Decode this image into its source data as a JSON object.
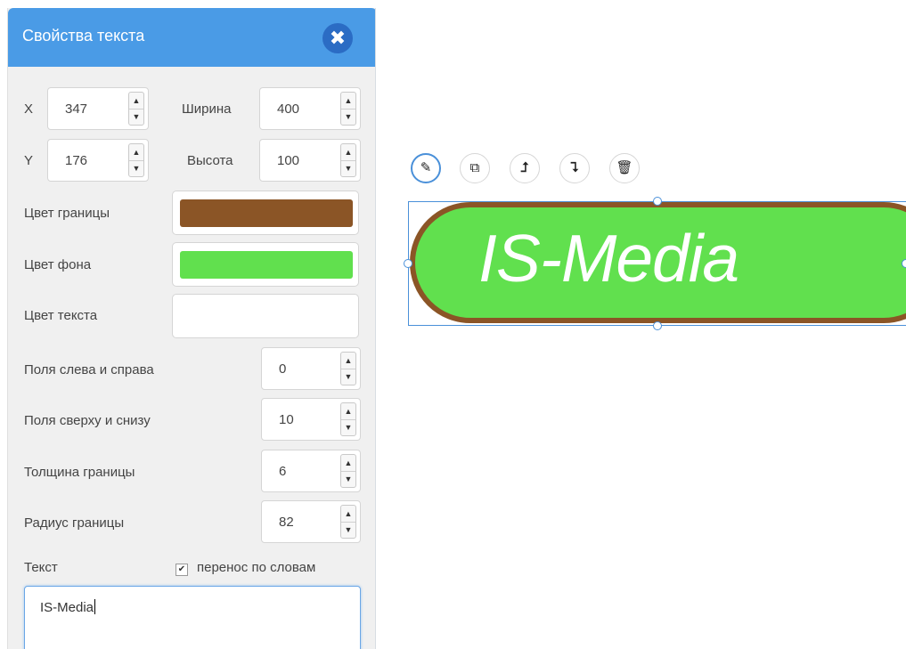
{
  "panel": {
    "title": "Свойства текста",
    "close_icon": "close-icon",
    "x": {
      "label": "X",
      "value": "347"
    },
    "y": {
      "label": "Y",
      "value": "176"
    },
    "width": {
      "label": "Ширина",
      "value": "400"
    },
    "height": {
      "label": "Высота",
      "value": "100"
    },
    "border_color": {
      "label": "Цвет границы",
      "color": "#8b5526"
    },
    "bg_color": {
      "label": "Цвет фона",
      "color": "#61e04e"
    },
    "text_color": {
      "label": "Цвет текста",
      "color": "#ffffff"
    },
    "padding_lr": {
      "label": "Поля слева и справа",
      "value": "0"
    },
    "padding_tb": {
      "label": "Поля сверху и снизу",
      "value": "10"
    },
    "border_width": {
      "label": "Толщина границы",
      "value": "6"
    },
    "border_radius": {
      "label": "Радиус границы",
      "value": "82"
    },
    "text_label": "Текст",
    "word_wrap_label": "перенос по словам",
    "word_wrap_checked": true,
    "text_value": "IS-Media"
  },
  "toolbar": {
    "edit_icon": "pencil-icon",
    "copy_icon": "copy-icon",
    "bring_forward_icon": "bring-forward-icon",
    "send_backward_icon": "send-backward-icon",
    "delete_icon": "trash-icon"
  },
  "canvas": {
    "element_text": "IS-Media"
  }
}
